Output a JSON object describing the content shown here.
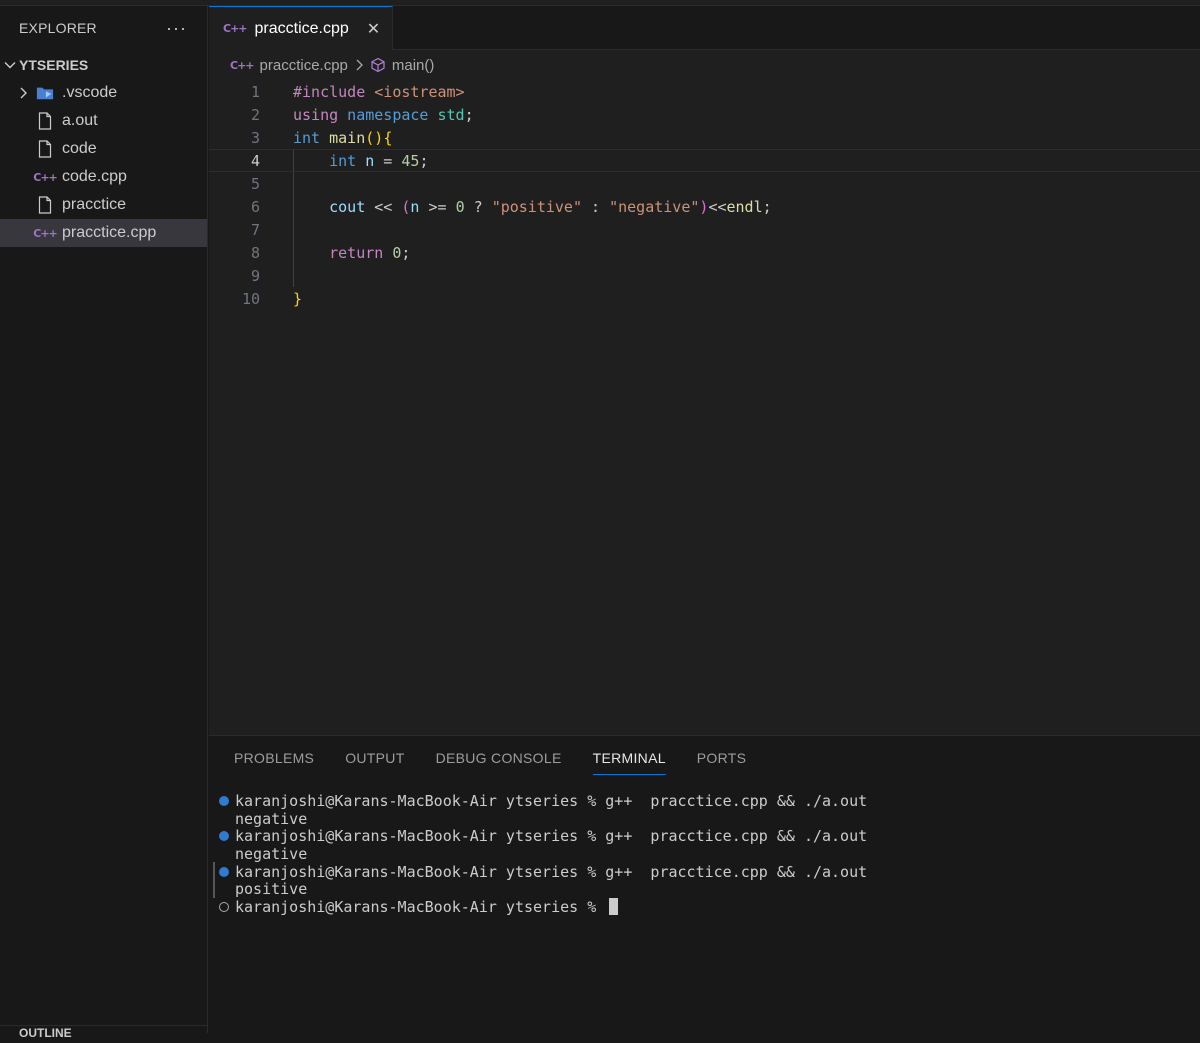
{
  "sidebar": {
    "title": "EXPLORER",
    "more": "···",
    "folder": "YTSERIES",
    "items": [
      {
        "label": ".vscode",
        "icon": "vscode-folder-icon"
      },
      {
        "label": "a.out",
        "icon": "file-icon"
      },
      {
        "label": "code",
        "icon": "file-icon"
      },
      {
        "label": "code.cpp",
        "icon": "cpp-file-icon"
      },
      {
        "label": "pracctice",
        "icon": "file-icon"
      },
      {
        "label": "pracctice.cpp",
        "icon": "cpp-file-icon"
      }
    ],
    "outline": "OUTLINE"
  },
  "cpp_glyph": "C++",
  "editor": {
    "tab": {
      "label": "pracctice.cpp",
      "close": "✕"
    },
    "breadcrumb": {
      "file": "pracctice.cpp",
      "symbol": "main()"
    },
    "line_numbers": [
      "1",
      "2",
      "3",
      "4",
      "5",
      "6",
      "7",
      "8",
      "9",
      "10"
    ],
    "code": {
      "l1_a": "#include",
      "l1_b": " <iostream>",
      "l2_a": "using",
      "l2_b": " namespace",
      "l2_c": " std",
      "l2_d": ";",
      "l3_a": "int",
      "l3_b": " main",
      "l3_c": "()",
      "l3_d": "{",
      "l4_a": "    int",
      "l4_b": " n",
      "l4_c": " = ",
      "l4_d": "45",
      "l4_e": ";",
      "l6_a": "    cout",
      "l6_b": " << ",
      "l6_c": "(",
      "l6_d": "n",
      "l6_e": " >= ",
      "l6_f": "0",
      "l6_g": " ? ",
      "l6_h": "\"positive\"",
      "l6_i": " : ",
      "l6_j": "\"negative\"",
      "l6_k": ")",
      "l6_l": "<<",
      "l6_m": "endl",
      "l6_n": ";",
      "l8_a": "    return",
      "l8_b": " ",
      "l8_c": "0",
      "l8_d": ";",
      "l10_a": "}"
    }
  },
  "panel": {
    "tabs": [
      "PROBLEMS",
      "OUTPUT",
      "DEBUG CONSOLE",
      "TERMINAL",
      "PORTS"
    ],
    "active_tab": "TERMINAL",
    "terminal": [
      {
        "type": "cmd",
        "text": "karanjoshi@Karans-MacBook-Air ytseries % g++  pracctice.cpp && ./a.out"
      },
      {
        "type": "out",
        "text": "negative"
      },
      {
        "type": "cmd",
        "text": "karanjoshi@Karans-MacBook-Air ytseries % g++  pracctice.cpp && ./a.out"
      },
      {
        "type": "out",
        "text": "negative"
      },
      {
        "type": "cmd",
        "text": "karanjoshi@Karans-MacBook-Air ytseries % g++  pracctice.cpp && ./a.out"
      },
      {
        "type": "out",
        "text": "positive"
      },
      {
        "type": "prompt",
        "text": "karanjoshi@Karans-MacBook-Air ytseries % "
      }
    ]
  }
}
